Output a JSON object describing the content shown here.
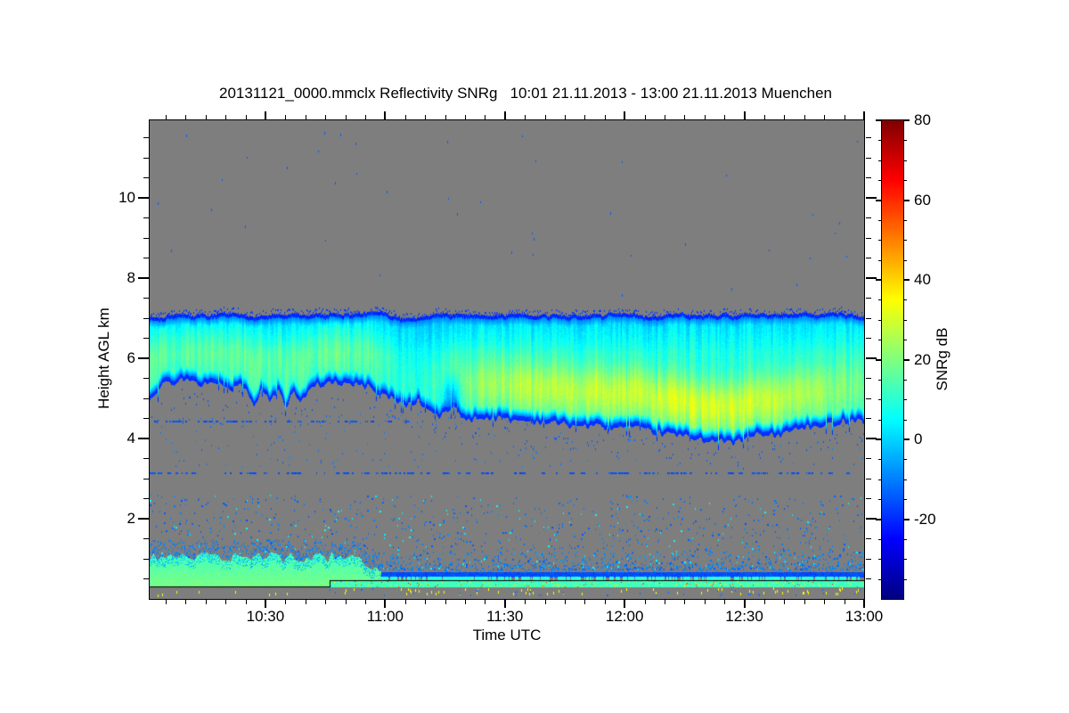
{
  "title": "20131121_0000.mmclx Reflectivity SNRg   10:01 21.11.2013 - 13:00 21.11.2013 Muenchen",
  "chart_data": {
    "type": "heatmap",
    "title": "20131121_0000.mmclx Reflectivity SNRg   10:01 21.11.2013 - 13:00 21.11.2013 Muenchen",
    "instrument_file": "20131121_0000.mmclx",
    "quantity": "Reflectivity SNRg",
    "site": "Muenchen",
    "time_start": "10:01 21.11.2013",
    "time_end": "13:00 21.11.2013",
    "xlabel": "Time UTC",
    "ylabel": "Height AGL km",
    "colorbar_label": "SNRg dB",
    "colormap": "jet",
    "no_signal_gray": "#7e7e7e",
    "value_range_db": [
      -40,
      80
    ],
    "colorbar_ticks": [
      {
        "label": "80",
        "value": 80
      },
      {
        "label": "60",
        "value": 60
      },
      {
        "label": "40",
        "value": 40
      },
      {
        "label": "20",
        "value": 20
      },
      {
        "label": "0",
        "value": 0
      },
      {
        "label": "-20",
        "value": -20
      }
    ],
    "colorbar_minor_step_db": 5,
    "x_axis": {
      "start_min": 601,
      "end_min": 780,
      "minor_step_min": 5,
      "major_ticks": [
        {
          "label": "10:30",
          "min": 630
        },
        {
          "label": "11:00",
          "min": 660
        },
        {
          "label": "11:30",
          "min": 690
        },
        {
          "label": "12:00",
          "min": 720
        },
        {
          "label": "12:30",
          "min": 750
        },
        {
          "label": "13:00",
          "min": 780
        }
      ]
    },
    "y_axis": {
      "min_km": 0,
      "max_km": 11.93,
      "minor_step_km": 0.5,
      "major_ticks": [
        {
          "label": "2",
          "km": 2
        },
        {
          "label": "4",
          "km": 4
        },
        {
          "label": "6",
          "km": 6
        },
        {
          "label": "8",
          "km": 8
        },
        {
          "label": "10",
          "km": 10
        }
      ]
    },
    "cloud_layer": {
      "description": "mid-level cloud deck between ~4 and ~7.1 km, tops flat near 7.1 km, base descending from ~5.4 km (10:00) to ~3.9 km (12:35)",
      "interior_snr_db": 8,
      "core_peak_snr_db": 28,
      "edge_snr_db": -17,
      "core_sigma_km": 0.68,
      "core_height_offset_km": 0.85,
      "core_height_max_km": 6.2,
      "top_km": [
        [
          0,
          7.0
        ],
        [
          8,
          7.08
        ],
        [
          20,
          7.1
        ],
        [
          30,
          7.05
        ],
        [
          40,
          7.08
        ],
        [
          50,
          7.1
        ],
        [
          54,
          7.18
        ],
        [
          58,
          7.12
        ],
        [
          62,
          7.02
        ],
        [
          68,
          7.06
        ],
        [
          75,
          7.1
        ],
        [
          85,
          7.08
        ],
        [
          95,
          7.1
        ],
        [
          105,
          7.06
        ],
        [
          115,
          7.1
        ],
        [
          125,
          7.08
        ],
        [
          135,
          7.1
        ],
        [
          145,
          7.06
        ],
        [
          155,
          7.1
        ],
        [
          165,
          7.08
        ],
        [
          172,
          7.12
        ],
        [
          179,
          7.05
        ]
      ],
      "base_km": [
        [
          0,
          5.05
        ],
        [
          3,
          5.35
        ],
        [
          8,
          5.5
        ],
        [
          12,
          5.35
        ],
        [
          16,
          5.45
        ],
        [
          20,
          5.25
        ],
        [
          24,
          5.35
        ],
        [
          26,
          4.85
        ],
        [
          28,
          5.2
        ],
        [
          30,
          4.95
        ],
        [
          32,
          5.25
        ],
        [
          34,
          4.8
        ],
        [
          36,
          5.2
        ],
        [
          38,
          4.95
        ],
        [
          41,
          5.3
        ],
        [
          45,
          5.42
        ],
        [
          50,
          5.38
        ],
        [
          55,
          5.3
        ],
        [
          58,
          5.12
        ],
        [
          61,
          5.0
        ],
        [
          64,
          4.85
        ],
        [
          67,
          4.95
        ],
        [
          70,
          4.7
        ],
        [
          73,
          4.55
        ],
        [
          76,
          4.85
        ],
        [
          78,
          4.55
        ],
        [
          80,
          4.5
        ],
        [
          85,
          4.55
        ],
        [
          90,
          4.48
        ],
        [
          95,
          4.45
        ],
        [
          100,
          4.42
        ],
        [
          105,
          4.35
        ],
        [
          110,
          4.32
        ],
        [
          115,
          4.3
        ],
        [
          120,
          4.28
        ],
        [
          125,
          4.2
        ],
        [
          130,
          4.12
        ],
        [
          135,
          4.05
        ],
        [
          140,
          3.98
        ],
        [
          144,
          3.92
        ],
        [
          148,
          3.95
        ],
        [
          152,
          4.12
        ],
        [
          156,
          4.08
        ],
        [
          160,
          4.18
        ],
        [
          164,
          4.3
        ],
        [
          168,
          4.28
        ],
        [
          172,
          4.42
        ],
        [
          176,
          4.5
        ],
        [
          179,
          4.45
        ]
      ],
      "core_intensity": [
        [
          0,
          0.35
        ],
        [
          30,
          0.4
        ],
        [
          55,
          0.35
        ],
        [
          65,
          0.25
        ],
        [
          75,
          0.45
        ],
        [
          85,
          0.7
        ],
        [
          95,
          0.85
        ],
        [
          105,
          0.9
        ],
        [
          115,
          0.95
        ],
        [
          125,
          1.0
        ],
        [
          135,
          1.05
        ],
        [
          145,
          1.05
        ],
        [
          155,
          0.95
        ],
        [
          165,
          0.8
        ],
        [
          172,
          0.55
        ],
        [
          179,
          0.45
        ]
      ]
    },
    "boundary_layer": {
      "description": "aerosol/insect layer below ~1.1 km, thick cyan-green band until ~11:00, thin stripes afterwards",
      "thick_band_until_min": 58,
      "band_top_km": 1.04,
      "band_base_km": 0.315,
      "band_snr_db": 19,
      "blue_stripe_km": [
        0.565,
        0.665
      ],
      "cyan_stripe_km": [
        0.475,
        0.555
      ],
      "clutter_stripe_km": [
        0.315,
        0.445
      ],
      "first_gate_step": {
        "before_km": 0.31,
        "after_km": 0.47,
        "step_min": 45
      }
    },
    "speckle_rows_km": [
      3.15,
      4.45
    ],
    "render_seed": 42
  },
  "colors": {
    "axis": "#000000",
    "text": "#000000"
  }
}
